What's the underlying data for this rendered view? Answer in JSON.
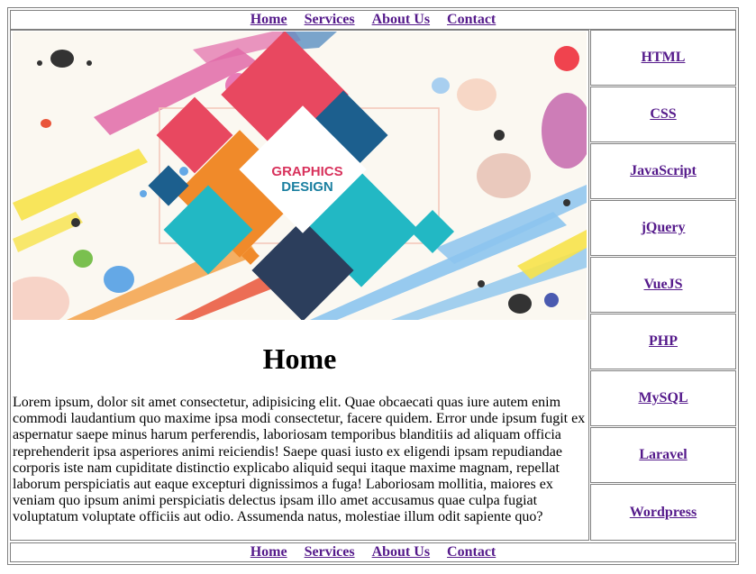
{
  "header": {
    "nav": [
      "Home",
      "Services",
      "About Us",
      "Contact"
    ]
  },
  "banner": {
    "line1": "GRAPHICS",
    "line2": "DESIGN"
  },
  "main": {
    "title": "Home",
    "paragraph": "Lorem ipsum, dolor sit amet consectetur, adipisicing elit. Quae obcaecati quas iure autem enim commodi laudantium quo maxime ipsa modi consectetur, facere quidem. Error unde ipsum fugit ex aspernatur saepe minus harum perferendis, laboriosam temporibus blanditiis ad aliquam officia reprehenderit ipsa asperiores animi reiciendis! Saepe quasi iusto ex eligendi ipsam repudiandae corporis iste nam cupiditate distinctio explicabo aliquid sequi itaque maxime magnam, repellat laborum perspiciatis aut eaque excepturi dignissimos a fuga! Laboriosam mollitia, maiores ex veniam quo ipsum animi perspiciatis delectus ipsam illo amet accusamus quae culpa fugiat voluptatum voluptate officiis aut odio. Assumenda natus, molestiae illum odit sapiente quo?"
  },
  "sidebar": {
    "items": [
      "HTML",
      "CSS",
      "JavaScript",
      "jQuery",
      "VueJS",
      "PHP",
      "MySQL",
      "Laravel",
      "Wordpress"
    ]
  },
  "footer": {
    "nav": [
      "Home",
      "Services",
      "About Us",
      "Contact"
    ]
  },
  "colors": {
    "link": "#551a8b",
    "border": "#808080"
  }
}
